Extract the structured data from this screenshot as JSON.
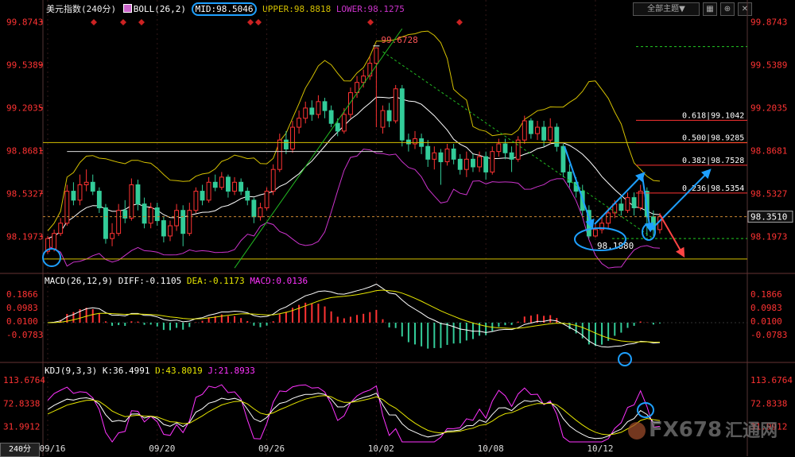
{
  "header": {
    "instrument": "美元指数",
    "period": "(240分)",
    "boll_label": "BOLL(26,2)",
    "mid_label": "MID:98.5046",
    "upper_label": "UPPER:98.8818",
    "lower_label": "LOWER:98.1275",
    "theme_button": "全部主题▼",
    "period_button": "240分",
    "icons": [
      "grid-icon",
      "zoom-icon",
      "close-icon"
    ]
  },
  "colors": {
    "up": "#ff3333",
    "down": "#33cc99",
    "mid_line": "#ffffff",
    "upper_band": "#d4c000",
    "lower_band": "#cc33cc",
    "axis_label": "#ff3333",
    "dif": "#ffffff",
    "dea": "#e6e600",
    "macd": "#ff33ff",
    "k": "#ffffff",
    "d": "#e6e600",
    "j": "#ff33ff",
    "annotation_blue": "#1ea0ff",
    "annotation_red": "#ff4444",
    "fib": "#ff3333",
    "yellow": "#d4c000",
    "green": "#22bb22"
  },
  "chart_data": [
    {
      "type": "candlestick",
      "panel": "price",
      "instrument": "美元指数",
      "interval": "240分",
      "indicator": "BOLL(26,2)",
      "ylim": [
        97.92,
        99.92
      ],
      "y_ticks": [
        "99.8743",
        "99.5389",
        "99.2035",
        "98.8681",
        "98.5327",
        "98.1973"
      ],
      "y_tick_values": [
        99.8743,
        99.5389,
        99.2035,
        98.8681,
        98.5327,
        98.1973
      ],
      "x_ticks": [
        "09/16",
        "09/20",
        "09/26",
        "10/02",
        "10/08",
        "10/12"
      ],
      "current_price": "98.3510",
      "current_value": 98.351,
      "high_label": "99.6728",
      "high_value": 99.6728,
      "low_label": "98.1880",
      "low_value": 98.188,
      "fib_levels": [
        {
          "label": "0.618",
          "value": 99.1042,
          "text": "99.1042"
        },
        {
          "label": "0.500",
          "value": 98.9285,
          "text": "98.9285"
        },
        {
          "label": "0.382",
          "value": 98.7528,
          "text": "98.7528"
        },
        {
          "label": "0.236",
          "value": 98.5354,
          "text": "98.5354"
        }
      ],
      "ohlc": [
        [
          98.08,
          98.18,
          98.06,
          98.2
        ],
        [
          98.1,
          98.22,
          98.08,
          98.25
        ],
        [
          98.22,
          98.3,
          98.2,
          98.34
        ],
        [
          98.3,
          98.55,
          98.28,
          98.6
        ],
        [
          98.55,
          98.48,
          98.44,
          98.62
        ],
        [
          98.48,
          98.6,
          98.44,
          98.68
        ],
        [
          98.6,
          98.62,
          98.55,
          98.72
        ],
        [
          98.62,
          98.55,
          98.52,
          98.68
        ],
        [
          98.55,
          98.42,
          98.38,
          98.58
        ],
        [
          98.42,
          98.18,
          98.14,
          98.45
        ],
        [
          98.18,
          98.22,
          98.12,
          98.3
        ],
        [
          98.22,
          98.4,
          98.2,
          98.45
        ],
        [
          98.4,
          98.34,
          98.3,
          98.48
        ],
        [
          98.34,
          98.6,
          98.32,
          98.65
        ],
        [
          98.6,
          98.45,
          98.4,
          98.64
        ],
        [
          98.45,
          98.3,
          98.26,
          98.5
        ],
        [
          98.3,
          98.42,
          98.26,
          98.46
        ],
        [
          98.42,
          98.32,
          98.28,
          98.46
        ],
        [
          98.32,
          98.2,
          98.15,
          98.35
        ],
        [
          98.2,
          98.28,
          98.16,
          98.32
        ],
        [
          98.28,
          98.4,
          98.24,
          98.45
        ],
        [
          98.4,
          98.22,
          98.12,
          98.44
        ],
        [
          98.22,
          98.4,
          98.2,
          98.46
        ],
        [
          98.4,
          98.55,
          98.38,
          98.58
        ],
        [
          98.55,
          98.48,
          98.44,
          98.6
        ],
        [
          98.48,
          98.62,
          98.46,
          98.66
        ],
        [
          98.62,
          98.58,
          98.55,
          98.68
        ],
        [
          98.58,
          98.66,
          98.56,
          98.7
        ],
        [
          98.66,
          98.55,
          98.5,
          98.68
        ],
        [
          98.55,
          98.62,
          98.52,
          98.66
        ],
        [
          98.62,
          98.55,
          98.52,
          98.65
        ],
        [
          98.55,
          98.48,
          98.44,
          98.58
        ],
        [
          98.48,
          98.35,
          98.3,
          98.5
        ],
        [
          98.35,
          98.42,
          98.32,
          98.46
        ],
        [
          98.42,
          98.55,
          98.4,
          98.58
        ],
        [
          98.55,
          98.72,
          98.52,
          98.76
        ],
        [
          98.72,
          98.95,
          98.7,
          99.0
        ],
        [
          98.95,
          98.88,
          98.84,
          99.02
        ],
        [
          98.88,
          99.05,
          98.85,
          99.1
        ],
        [
          99.05,
          99.12,
          99.0,
          99.18
        ],
        [
          99.12,
          99.2,
          99.08,
          99.25
        ],
        [
          99.2,
          99.15,
          99.1,
          99.26
        ],
        [
          99.15,
          99.25,
          99.12,
          99.3
        ],
        [
          99.25,
          99.18,
          99.12,
          99.28
        ],
        [
          99.18,
          99.08,
          99.05,
          99.22
        ],
        [
          99.08,
          99.02,
          98.98,
          99.12
        ],
        [
          99.02,
          99.15,
          99.0,
          99.2
        ],
        [
          99.15,
          99.32,
          99.12,
          99.36
        ],
        [
          99.32,
          99.4,
          99.28,
          99.45
        ],
        [
          99.4,
          99.45,
          99.36,
          99.5
        ],
        [
          99.45,
          99.55,
          99.42,
          99.6
        ],
        [
          99.55,
          99.67,
          99.05,
          99.6728
        ],
        [
          99.05,
          99.18,
          99.0,
          99.22
        ],
        [
          99.18,
          99.1,
          99.05,
          99.24
        ],
        [
          99.1,
          99.35,
          99.08,
          99.38
        ],
        [
          99.35,
          98.95,
          98.9,
          99.38
        ],
        [
          98.95,
          98.92,
          98.86,
          99.0
        ],
        [
          98.92,
          98.96,
          98.88,
          99.02
        ],
        [
          98.96,
          98.9,
          98.84,
          99.0
        ],
        [
          98.9,
          98.8,
          98.74,
          98.95
        ],
        [
          98.8,
          98.85,
          98.72,
          98.9
        ],
        [
          98.85,
          98.78,
          98.6,
          98.88
        ],
        [
          98.78,
          98.88,
          98.75,
          98.92
        ],
        [
          98.88,
          98.8,
          98.76,
          98.92
        ],
        [
          98.8,
          98.72,
          98.68,
          98.84
        ],
        [
          98.72,
          98.8,
          98.66,
          98.86
        ],
        [
          98.8,
          98.74,
          98.7,
          98.84
        ],
        [
          98.74,
          98.82,
          98.7,
          98.86
        ],
        [
          98.82,
          98.7,
          98.64,
          98.86
        ],
        [
          98.7,
          98.86,
          98.68,
          98.9
        ],
        [
          98.86,
          98.92,
          98.82,
          98.96
        ],
        [
          98.92,
          98.85,
          98.8,
          98.96
        ],
        [
          98.85,
          98.8,
          98.7,
          98.9
        ],
        [
          98.8,
          98.95,
          98.78,
          98.98
        ],
        [
          98.95,
          99.1,
          98.92,
          99.14
        ],
        [
          99.1,
          99.0,
          98.96,
          99.12
        ],
        [
          99.0,
          99.05,
          98.95,
          99.1
        ],
        [
          99.05,
          98.95,
          98.9,
          99.1
        ],
        [
          98.95,
          99.05,
          98.92,
          99.12
        ],
        [
          99.05,
          98.9,
          98.86,
          99.08
        ],
        [
          98.9,
          98.7,
          98.66,
          98.92
        ],
        [
          98.7,
          98.62,
          98.58,
          98.76
        ],
        [
          98.62,
          98.55,
          98.5,
          98.66
        ],
        [
          98.55,
          98.4,
          98.36,
          98.6
        ],
        [
          98.4,
          98.2,
          98.18,
          98.44
        ],
        [
          98.2,
          98.25,
          98.188,
          98.3
        ],
        [
          98.25,
          98.3,
          98.22,
          98.36
        ],
        [
          98.3,
          98.38,
          98.26,
          98.42
        ],
        [
          98.38,
          98.45,
          98.34,
          98.48
        ],
        [
          98.45,
          98.4,
          98.36,
          98.5
        ],
        [
          98.4,
          98.5,
          98.38,
          98.54
        ],
        [
          98.5,
          98.42,
          98.36,
          98.54
        ],
        [
          98.42,
          98.55,
          98.4,
          98.6
        ],
        [
          98.55,
          98.35,
          98.2,
          98.58
        ],
        [
          98.35,
          98.25,
          98.2,
          98.4
        ],
        [
          98.25,
          98.351,
          98.22,
          98.38
        ]
      ],
      "series": [
        {
          "name": "MID",
          "value": 98.5046
        },
        {
          "name": "UPPER",
          "value": 98.8818
        },
        {
          "name": "LOWER",
          "value": 98.1275
        }
      ]
    },
    {
      "type": "macd",
      "panel": "macd",
      "indicator": "MACD(26,12,9)",
      "diff_label": "DIFF:-0.1105",
      "dea_label": "DEA:-0.1173",
      "macd_label": "MACD:0.0136",
      "ylim": [
        -0.24,
        0.24
      ],
      "y_ticks": [
        "0.1866",
        "0.0983",
        "0.0100",
        "-0.0783"
      ],
      "y_tick_values": [
        0.1866,
        0.0983,
        0.01,
        -0.0783
      ],
      "series": [
        {
          "name": "DIFF",
          "value": -0.1105
        },
        {
          "name": "DEA",
          "value": -0.1173
        },
        {
          "name": "MACD",
          "value": 0.0136
        }
      ]
    },
    {
      "type": "kdj",
      "panel": "kdj",
      "indicator": "KDJ(9,3,3)",
      "k_label": "K:36.4991",
      "d_label": "D:43.8019",
      "j_label": "J:21.8933",
      "ylim": [
        5,
        125
      ],
      "y_ticks": [
        "113.6764",
        "72.8338",
        "31.9912"
      ],
      "y_tick_values": [
        113.6764,
        72.8338,
        31.9912
      ],
      "series": [
        {
          "name": "K",
          "value": 36.4991
        },
        {
          "name": "D",
          "value": 43.8019
        },
        {
          "name": "J",
          "value": 21.8933
        }
      ]
    }
  ],
  "watermark": {
    "brand": "FX678",
    "cn": "汇通网"
  }
}
